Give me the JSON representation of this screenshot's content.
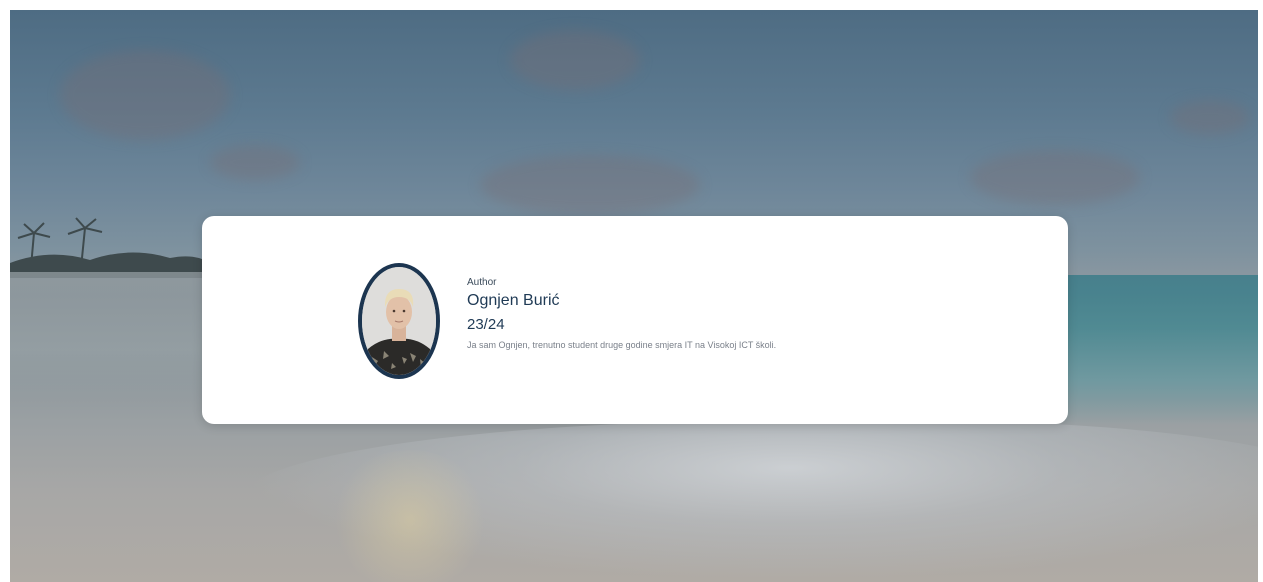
{
  "background": {
    "description_icon": "beach-sunset-background"
  },
  "author_card": {
    "label": "Author",
    "name": "Ognjen Burić",
    "year": "23/24",
    "description": "Ja sam Ognjen, trenutno student druge godine smjera IT na Visokoj ICT školi.",
    "avatar_icon": "author-photo"
  },
  "colors": {
    "avatar_border": "#1c3550",
    "name_text": "#1f3a55",
    "card_background": "#ffffff"
  }
}
